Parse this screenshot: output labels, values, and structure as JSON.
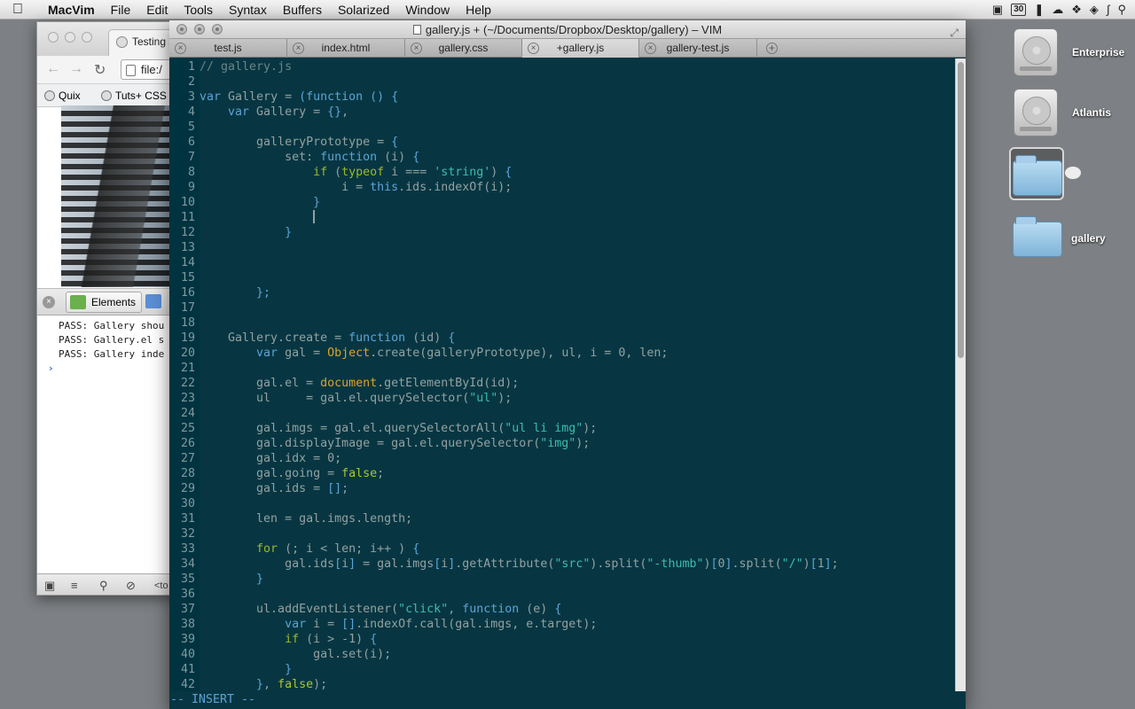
{
  "menubar": {
    "app": "MacVim",
    "items": [
      "File",
      "Edit",
      "Tools",
      "Syntax",
      "Buffers",
      "Solarized",
      "Window",
      "Help"
    ],
    "calendar_day": "30"
  },
  "chrome": {
    "tab_title": "Testing",
    "address": "file:/",
    "bookmarks": [
      "Quix",
      "Tuts+ CSS"
    ],
    "devtools_tab": "Elements",
    "console_lines": [
      "PASS: Gallery shou",
      "PASS: Gallery.el s",
      "PASS: Gallery inde"
    ],
    "console_prompt": "›",
    "status_text": "<to"
  },
  "vim": {
    "title": "gallery.js + (~/Documents/Dropbox/Desktop/gallery) – VIM",
    "tabs": [
      {
        "label": "test.js"
      },
      {
        "label": "index.html"
      },
      {
        "label": "gallery.css"
      },
      {
        "label": "+gallery.js",
        "active": true
      },
      {
        "label": "gallery-test.js"
      }
    ],
    "mode": "-- INSERT --",
    "lines": [
      [
        [
          "// gallery.js",
          "comment"
        ]
      ],
      [],
      [
        [
          "var ",
          "keyword"
        ],
        [
          "Gallery = ",
          "plain"
        ],
        [
          "(",
          "bracket"
        ],
        [
          "function ",
          "keyword"
        ],
        [
          "() {",
          "bracket"
        ]
      ],
      [
        [
          "    var ",
          "keyword"
        ],
        [
          "Gallery = ",
          "plain"
        ],
        [
          "{}",
          "bracket"
        ],
        [
          ",",
          "plain"
        ]
      ],
      [],
      [
        [
          "        galleryPrototype = ",
          "plain"
        ],
        [
          "{",
          "bracket"
        ]
      ],
      [
        [
          "            set: ",
          "plain"
        ],
        [
          "function ",
          "keyword"
        ],
        [
          "(i) ",
          "plain"
        ],
        [
          "{",
          "bracket"
        ]
      ],
      [
        [
          "                if ",
          "statement"
        ],
        [
          "(",
          "plain"
        ],
        [
          "typeof ",
          "statement"
        ],
        [
          "i === ",
          "plain"
        ],
        [
          "'string'",
          "string"
        ],
        [
          ") ",
          "plain"
        ],
        [
          "{",
          "bracket"
        ]
      ],
      [
        [
          "                    i = ",
          "plain"
        ],
        [
          "this",
          "keyword"
        ],
        [
          ".ids.indexOf(i);",
          "plain"
        ]
      ],
      [
        [
          "                }",
          "bracket"
        ]
      ],
      [
        [
          "                ",
          "plain"
        ]
      ],
      [
        [
          "            }",
          "bracket"
        ]
      ],
      [],
      [],
      [],
      [
        [
          "        };",
          "bracket"
        ]
      ],
      [],
      [],
      [
        [
          "    Gallery.create = ",
          "plain"
        ],
        [
          "function ",
          "keyword"
        ],
        [
          "(id) ",
          "plain"
        ],
        [
          "{",
          "bracket"
        ]
      ],
      [
        [
          "        var ",
          "keyword"
        ],
        [
          "gal = ",
          "plain"
        ],
        [
          "Object",
          "builtin"
        ],
        [
          ".create(galleryPrototype), ul, i = 0, len;",
          "plain"
        ]
      ],
      [],
      [
        [
          "        gal.el = ",
          "plain"
        ],
        [
          "document",
          "builtin"
        ],
        [
          ".getElementById(id);",
          "plain"
        ]
      ],
      [
        [
          "        ul     = gal.el.querySelector(",
          "plain"
        ],
        [
          "\"ul\"",
          "string"
        ],
        [
          ");",
          "plain"
        ]
      ],
      [],
      [
        [
          "        gal.imgs = gal.el.querySelectorAll(",
          "plain"
        ],
        [
          "\"ul li img\"",
          "string"
        ],
        [
          ");",
          "plain"
        ]
      ],
      [
        [
          "        gal.displayImage = gal.el.querySelector(",
          "plain"
        ],
        [
          "\"img\"",
          "string"
        ],
        [
          ");",
          "plain"
        ]
      ],
      [
        [
          "        gal.idx = 0;",
          "plain"
        ]
      ],
      [
        [
          "        gal.going = ",
          "plain"
        ],
        [
          "false",
          "bool"
        ],
        [
          ";",
          "plain"
        ]
      ],
      [
        [
          "        gal.ids = ",
          "plain"
        ],
        [
          "[]",
          "bracket"
        ],
        [
          ";",
          "plain"
        ]
      ],
      [],
      [
        [
          "        len = gal.imgs.length;",
          "plain"
        ]
      ],
      [],
      [
        [
          "        for ",
          "statement"
        ],
        [
          "(; i < len; i++ ) ",
          "plain"
        ],
        [
          "{",
          "bracket"
        ]
      ],
      [
        [
          "            gal.ids",
          "plain"
        ],
        [
          "[",
          "bracket"
        ],
        [
          "i",
          "plain"
        ],
        [
          "]",
          "bracket"
        ],
        [
          " = gal.imgs",
          "plain"
        ],
        [
          "[",
          "bracket"
        ],
        [
          "i",
          "plain"
        ],
        [
          "]",
          "bracket"
        ],
        [
          ".getAttribute(",
          "plain"
        ],
        [
          "\"src\"",
          "string"
        ],
        [
          ").split(",
          "plain"
        ],
        [
          "\"-thumb\"",
          "string"
        ],
        [
          ")",
          "plain"
        ],
        [
          "[",
          "bracket"
        ],
        [
          "0",
          "plain"
        ],
        [
          "]",
          "bracket"
        ],
        [
          ".split(",
          "plain"
        ],
        [
          "\"/\"",
          "string"
        ],
        [
          ")",
          "plain"
        ],
        [
          "[",
          "bracket"
        ],
        [
          "1",
          "plain"
        ],
        [
          "]",
          "bracket"
        ],
        [
          ";",
          "plain"
        ]
      ],
      [
        [
          "        }",
          "bracket"
        ]
      ],
      [],
      [
        [
          "        ul.addEventListener(",
          "plain"
        ],
        [
          "\"click\"",
          "string"
        ],
        [
          ", ",
          "plain"
        ],
        [
          "function ",
          "keyword"
        ],
        [
          "(e) ",
          "plain"
        ],
        [
          "{",
          "bracket"
        ]
      ],
      [
        [
          "            var ",
          "keyword"
        ],
        [
          "i = ",
          "plain"
        ],
        [
          "[]",
          "bracket"
        ],
        [
          ".indexOf.call(gal.imgs, e.target);",
          "plain"
        ]
      ],
      [
        [
          "            if ",
          "statement"
        ],
        [
          "(i > -1) ",
          "plain"
        ],
        [
          "{",
          "bracket"
        ]
      ],
      [
        [
          "                gal.set(i);",
          "plain"
        ]
      ],
      [
        [
          "            }",
          "bracket"
        ]
      ],
      [
        [
          "        }",
          "bracket"
        ],
        [
          ", ",
          "plain"
        ],
        [
          "false",
          "bool"
        ],
        [
          ");",
          "plain"
        ]
      ]
    ]
  },
  "desktop": {
    "icons": [
      {
        "label": "Enterprise",
        "kind": "drive"
      },
      {
        "label": "Atlantis",
        "kind": "drive"
      },
      {
        "label": "",
        "kind": "folder"
      },
      {
        "label": "gallery",
        "kind": "folder"
      }
    ]
  }
}
